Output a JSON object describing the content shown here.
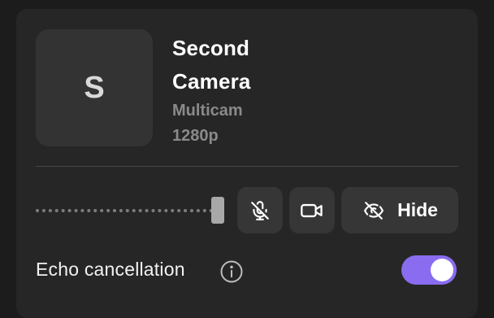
{
  "source": {
    "avatar_letter": "S",
    "name_line1": "Second",
    "name_line2": "Camera",
    "type": "Multicam",
    "resolution": "1280p"
  },
  "controls": {
    "volume_level": 1.0,
    "mic_icon": "mic-off-icon",
    "camera_icon": "video-camera-icon",
    "hide_icon": "eye-off-icon",
    "hide_label": "Hide"
  },
  "settings": {
    "echo_cancellation_label": "Echo cancellation",
    "echo_cancellation_enabled": true,
    "info_icon": "info-icon"
  },
  "colors": {
    "toggle_accent": "#8a6cf0",
    "panel_bg": "#262626",
    "button_bg": "#363636"
  }
}
